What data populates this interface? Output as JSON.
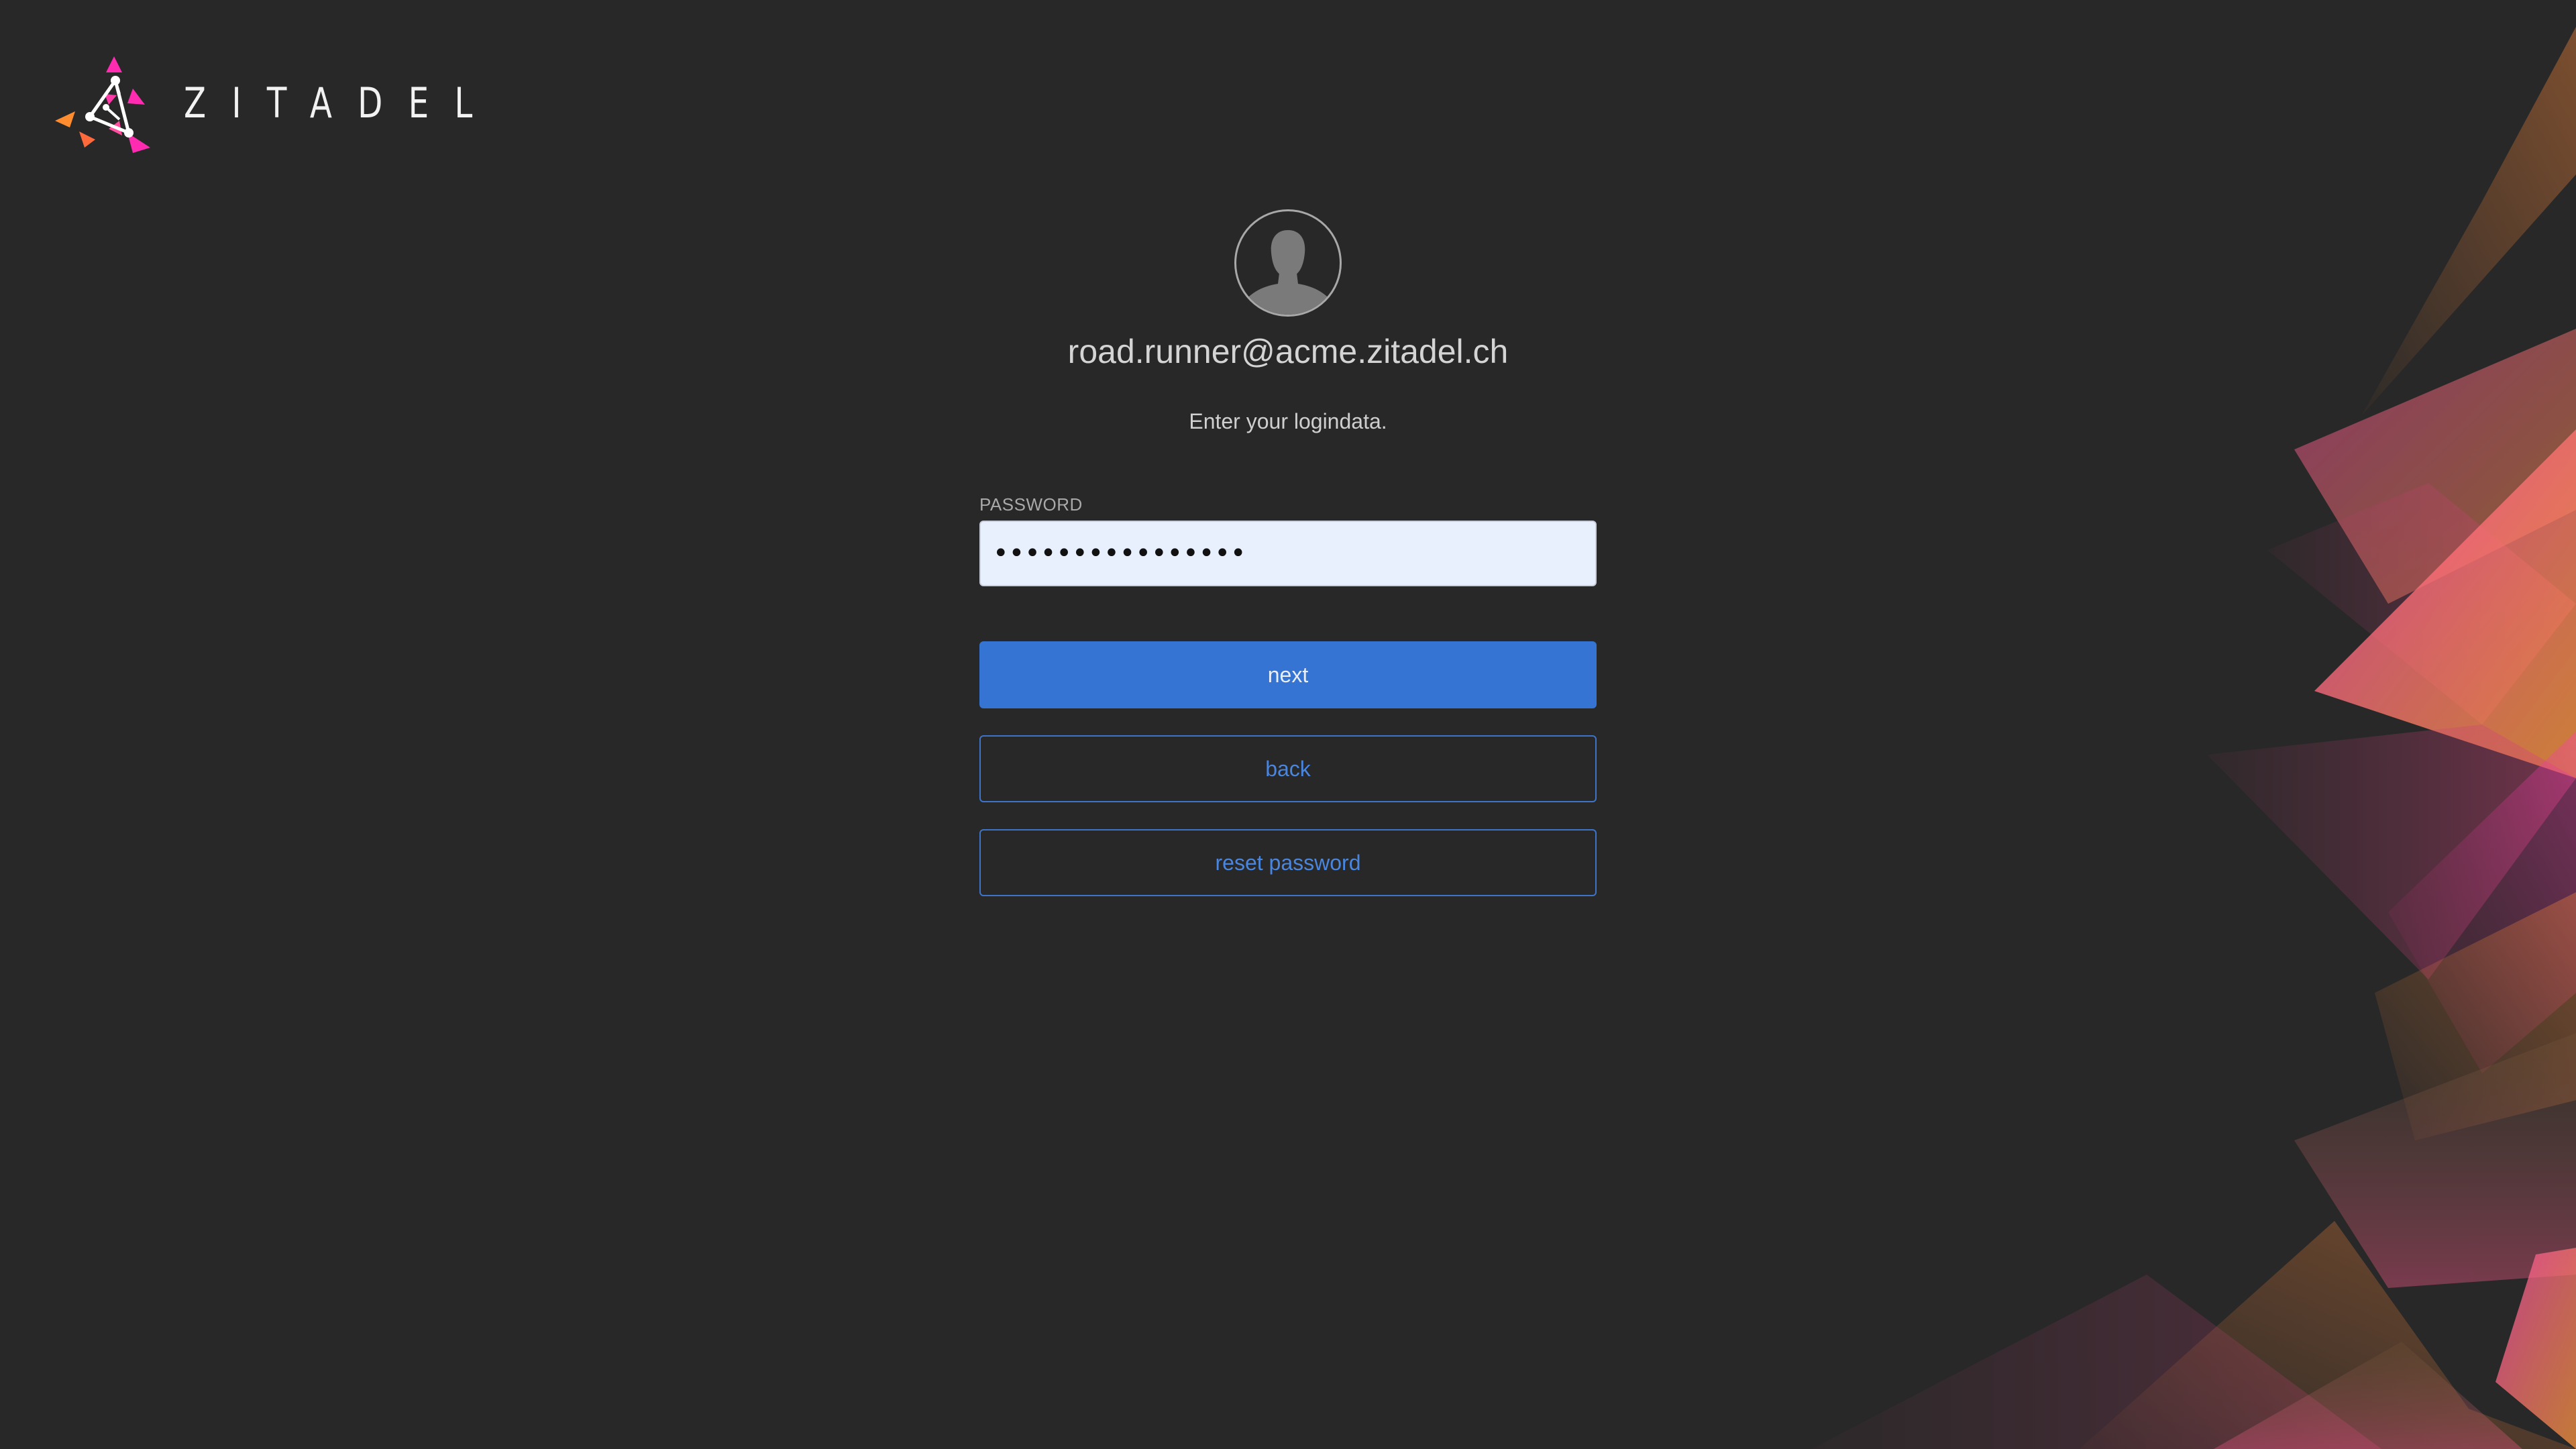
{
  "brand": {
    "name": "ZITADEL",
    "logo_icon": "zitadel-logo-icon",
    "colors": {
      "accent": "#3574d2",
      "background": "#282828",
      "logo_pink": "#ff2bb0",
      "logo_orange": "#ff8c2e"
    }
  },
  "user": {
    "display_name": "road.runner@acme.zitadel.ch",
    "avatar_icon": "user-avatar-icon"
  },
  "instruction": "Enter your logindata.",
  "password": {
    "label": "PASSWORD",
    "value": "••••••••••••••••",
    "type": "password"
  },
  "actions": {
    "next_label": "next",
    "back_label": "back",
    "reset_password_label": "reset password"
  }
}
